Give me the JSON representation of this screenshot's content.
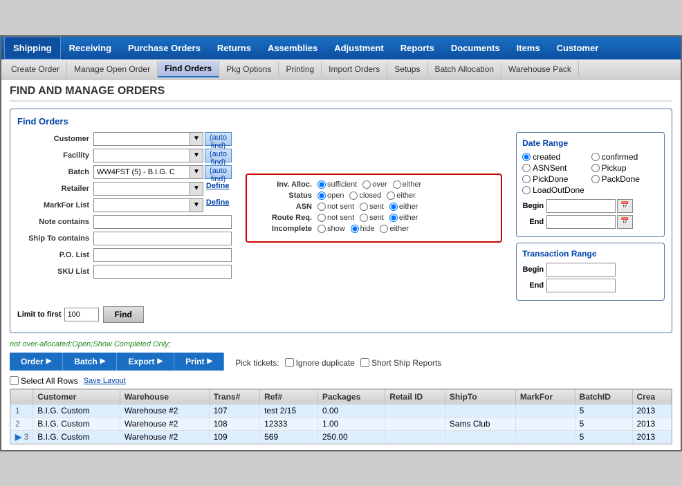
{
  "app": {
    "title": "Shipping",
    "menuItems": [
      "Receiving",
      "Purchase Orders",
      "Returns",
      "Assemblies",
      "Adjustment",
      "Reports",
      "Documents",
      "Items",
      "Customer"
    ],
    "subMenuItems": [
      "Create Order",
      "Manage Open Order",
      "Find Orders",
      "Pkg Options",
      "Printing",
      "Import Orders",
      "Setups",
      "Batch Allocation",
      "Warehouse Pack"
    ],
    "activeSubMenu": "Find Orders"
  },
  "page": {
    "title": "Find and Manage Orders"
  },
  "findOrders": {
    "sectionTitle": "Find Orders",
    "labels": {
      "customer": "Customer",
      "facility": "Facility",
      "batch": "Batch",
      "retailer": "Retailer",
      "markForList": "MarkFor List",
      "noteContains": "Note contains",
      "shipToContains": "Ship To contains",
      "poList": "P.O. List",
      "skuList": "SKU List",
      "limitToFirst": "Limit to first"
    },
    "batchValue": "WW4FST (5) - B.I.G. C",
    "limitValue": "100",
    "autoFind1": "(auto find)",
    "autoFind2": "(auto find)",
    "autoFind3": "(auto find)",
    "define1": "Define",
    "define2": "Define",
    "findBtn": "Find"
  },
  "invAlloc": {
    "label": "Inv. Alloc.",
    "options": [
      "sufficient",
      "over",
      "either"
    ],
    "selected": "sufficient"
  },
  "status": {
    "label": "Status",
    "options": [
      "open",
      "closed",
      "either"
    ],
    "selected": "open"
  },
  "asn": {
    "label": "ASN",
    "options": [
      "not sent",
      "sent",
      "either"
    ],
    "selected": "either"
  },
  "routeReq": {
    "label": "Route Req.",
    "options": [
      "not sent",
      "sent",
      "either"
    ],
    "selected": "either"
  },
  "incomplete": {
    "label": "Incomplete",
    "options": [
      "show",
      "hide",
      "either"
    ],
    "selected": "hide"
  },
  "dateRange": {
    "title": "Date Range",
    "radioOptions": [
      "created",
      "confirmed",
      "ASNSent",
      "Pickup",
      "PickDone",
      "PackDone",
      "LoadOutDone"
    ],
    "selected": "created",
    "beginLabel": "Begin",
    "endLabel": "End"
  },
  "transRange": {
    "title": "Transaction Range",
    "beginLabel": "Begin",
    "endLabel": "End"
  },
  "statusText": "not over-allocated;Open;Show Completed Only;",
  "toolbar": {
    "orderBtn": "Order",
    "batchBtn": "Batch",
    "exportBtn": "Export",
    "printBtn": "Print",
    "pickTicketsLabel": "Pick tickets:",
    "ignoreDuplicateLabel": "Ignore duplicate",
    "shortShipReportsLabel": "Short Ship Reports"
  },
  "selectRow": {
    "selectAllLabel": "Select All Rows",
    "saveLayoutLabel": "Save Layout"
  },
  "tableHeaders": [
    "",
    "Customer",
    "Warehouse",
    "Trans#",
    "Ref#",
    "Packages",
    "Retail ID",
    "ShipTo",
    "MarkFor",
    "BatchID",
    "Crea"
  ],
  "tableRows": [
    {
      "num": "1",
      "customer": "B.I.G. Custom",
      "warehouse": "Warehouse #2",
      "trans": "107",
      "ref": "test 2/15",
      "packages": "0.00",
      "retailId": "",
      "shipTo": "",
      "markFor": "",
      "batchId": "5",
      "created": "2013"
    },
    {
      "num": "2",
      "customer": "B.I.G. Custom",
      "warehouse": "Warehouse #2",
      "trans": "108",
      "ref": "12333",
      "packages": "1.00",
      "retailId": "",
      "shipTo": "Sams Club",
      "markFor": "",
      "batchId": "5",
      "created": "2013"
    },
    {
      "num": "3",
      "customer": "B.I.G. Custom",
      "warehouse": "Warehouse #2",
      "trans": "109",
      "ref": "569",
      "packages": "250.00",
      "retailId": "",
      "shipTo": "",
      "markFor": "",
      "batchId": "5",
      "created": "2013"
    }
  ]
}
